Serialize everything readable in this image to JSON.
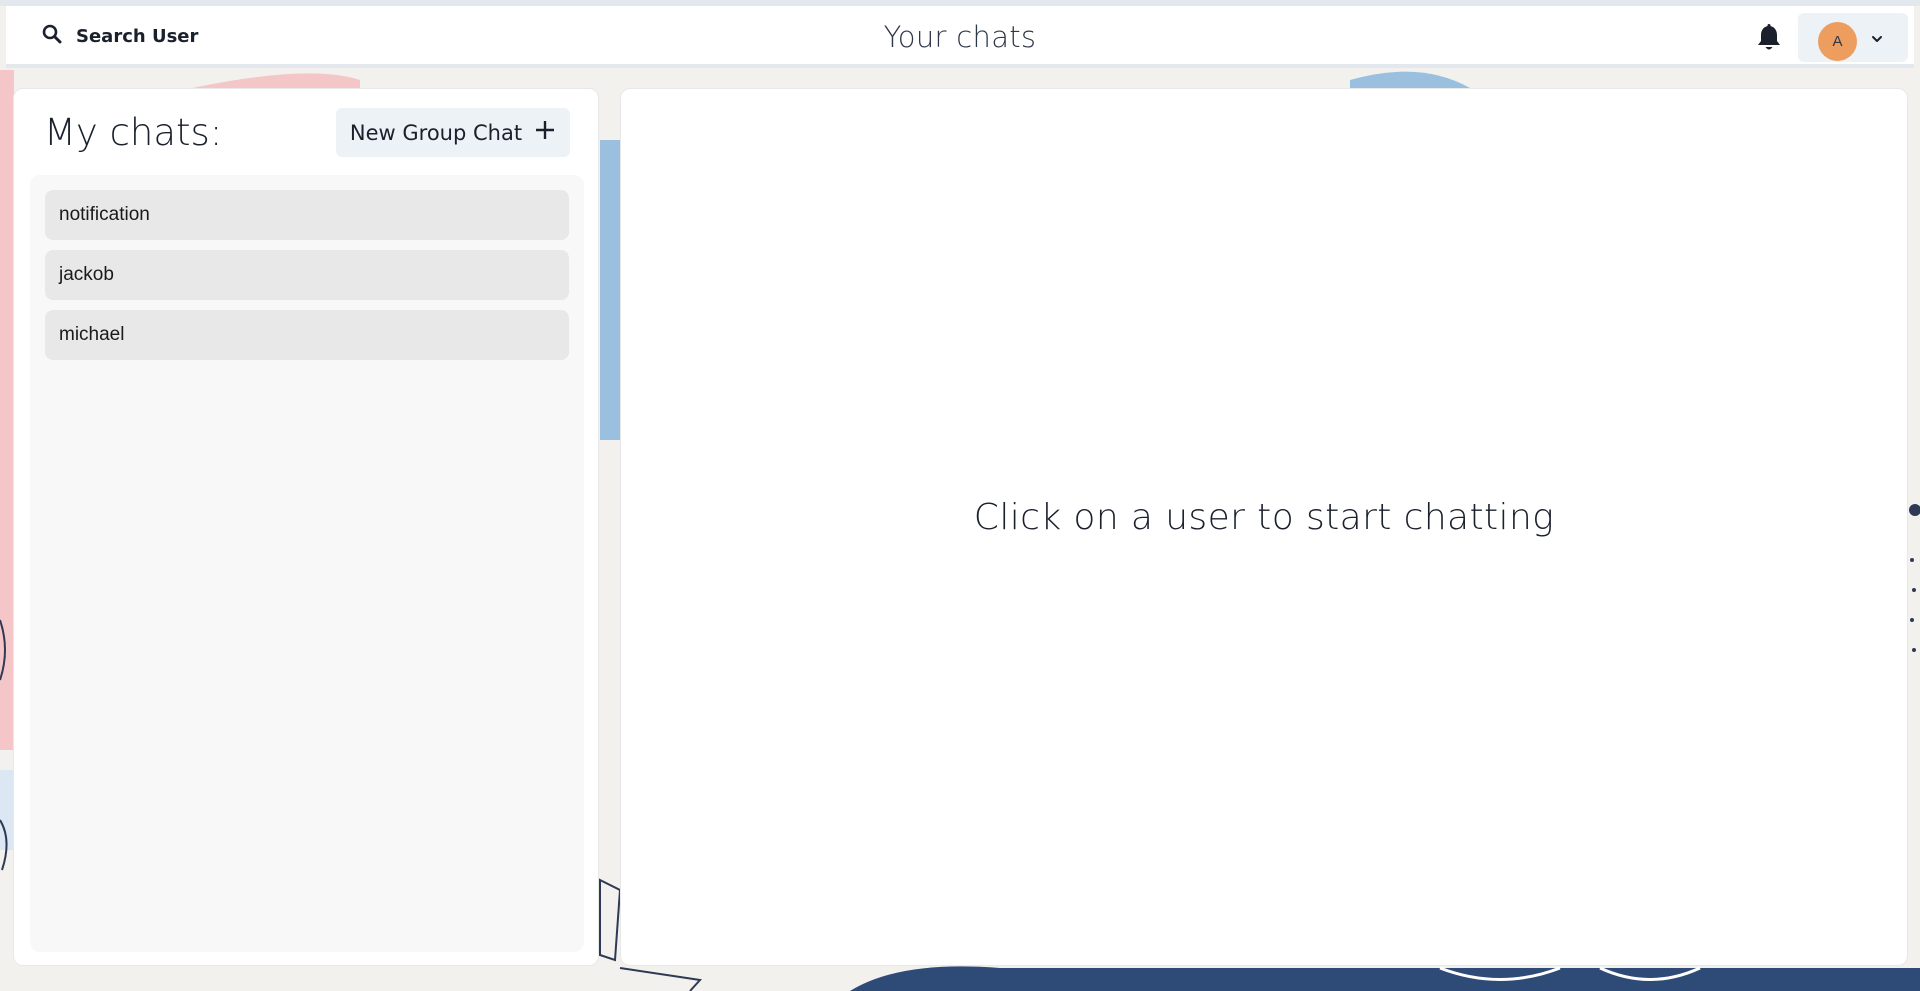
{
  "header": {
    "search_label": "Search User",
    "title": "Your chats",
    "avatar_initial": "A"
  },
  "sidebar": {
    "title": "My chats:",
    "new_group_label": "New Group Chat",
    "chats": [
      {
        "name": "notification"
      },
      {
        "name": "jackob"
      },
      {
        "name": "michael"
      }
    ]
  },
  "main": {
    "empty_message": "Click on a user to start chatting"
  },
  "colors": {
    "avatar_bg": "#ed9e5f",
    "button_bg": "#edf2f7",
    "chat_item_bg": "#e8e8e8"
  },
  "icons": [
    "search-icon",
    "bell-icon",
    "chevron-down-icon",
    "plus-icon"
  ]
}
